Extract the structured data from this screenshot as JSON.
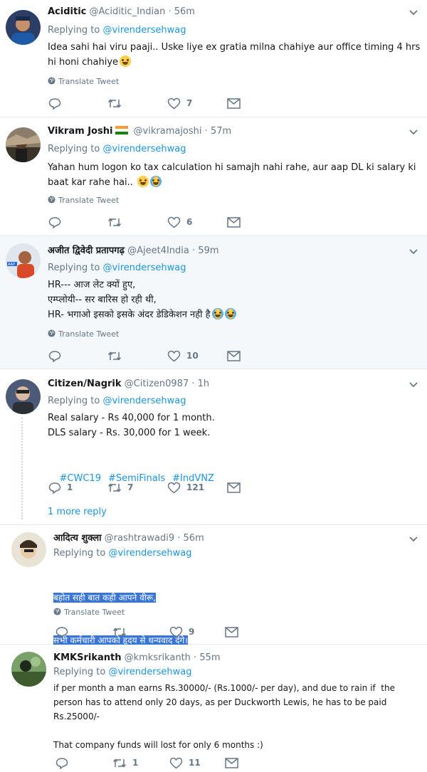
{
  "tweets": [
    {
      "name": "Aciditic",
      "handle": "@Aciditic_Indian",
      "dot": "·",
      "time": "56m",
      "replying_prefix": "Replying to ",
      "replying_to": "@virendersehwag",
      "text": "Idea sahi hai viru paaji.. Uske liye ex gratia milna chahiye aur office timing 4 hrs hi honi chahiye",
      "translate": "Translate Tweet",
      "replies": "",
      "retweets": "",
      "likes": "7"
    },
    {
      "name": "Vikram Joshi",
      "handle": "@vikramajoshi",
      "dot": "·",
      "time": "57m",
      "replying_prefix": "Replying to ",
      "replying_to": "@virendersehwag",
      "text": "Yahan hum logon ko tax calculation hi samajh nahi rahe, aur aap DL ki salary ki baat kar rahe hai..",
      "translate": "Translate Tweet",
      "replies": "",
      "retweets": "",
      "likes": "6"
    },
    {
      "name": "अजीत द्विवेदी प्रतापगढ़",
      "handle": "@Ajeet4India",
      "dot": "·",
      "time": "59m",
      "replying_prefix": "Replying to ",
      "replying_to": "@virendersehwag",
      "text": "HR--- आज लेट क्यों हुए,\nएम्प्लोयी-- सर बारिस हो रही थी,\nHR- भगाओ इसको इसके अंदर डेडिकेशन नही है",
      "translate": "Translate Tweet",
      "replies": "",
      "retweets": "",
      "likes": "10"
    },
    {
      "name": "Citizen/Nagrik",
      "handle": "@Citizen0987",
      "dot": "·",
      "time": "1h",
      "replying_prefix": "Replying to ",
      "replying_to": "@virendersehwag",
      "text": "Real salary - Rs 40,000 for 1 month.\nDLS salary - Rs. 30,000 for 1 week.",
      "hashtags": [
        "#CWC19",
        "#SemiFinals",
        "#IndVNZ"
      ],
      "replies": "1",
      "retweets": "7",
      "likes": "121",
      "more_reply": "1 more reply"
    },
    {
      "name": "आदित्य शुक्ला",
      "handle": "@rashtrawadi9",
      "dot": "·",
      "time": "56m",
      "replying_prefix": "Replying to ",
      "replying_to": "@virendersehwag",
      "text_line1": "बहोत सही बात कही आपने वीरू,",
      "text_line2": "सभी कर्मचारी आपको हृदय से धन्यवाद देंगे।",
      "translate": "Translate Tweet",
      "replies": "",
      "retweets": "",
      "likes": "9"
    },
    {
      "name": "KMKSrikanth",
      "handle": "@kmksrikanth",
      "dot": "·",
      "time": "55m",
      "replying_prefix": "Replying to ",
      "replying_to": "@virendersehwag",
      "text": "if per month a man earns Rs.30000/- (Rs.1000/- per day), and due to rain if  the person has to attend only 20 days, as per Duckworth Lewis, he has to be paid Rs.25000/-\n\nThat company funds will lost for only 6 months :)",
      "replies": "",
      "retweets": "1",
      "likes": "11"
    }
  ],
  "colors": {
    "link": "#1b95e0",
    "muted": "#657786",
    "divider": "#e6ecf0",
    "highlight_bg": "#f5f8fa",
    "selection": "#3875d7"
  },
  "icons": [
    "reply-icon",
    "retweet-icon",
    "like-icon",
    "message-icon",
    "globe-icon",
    "caret-down-icon",
    "india-flag-icon"
  ]
}
